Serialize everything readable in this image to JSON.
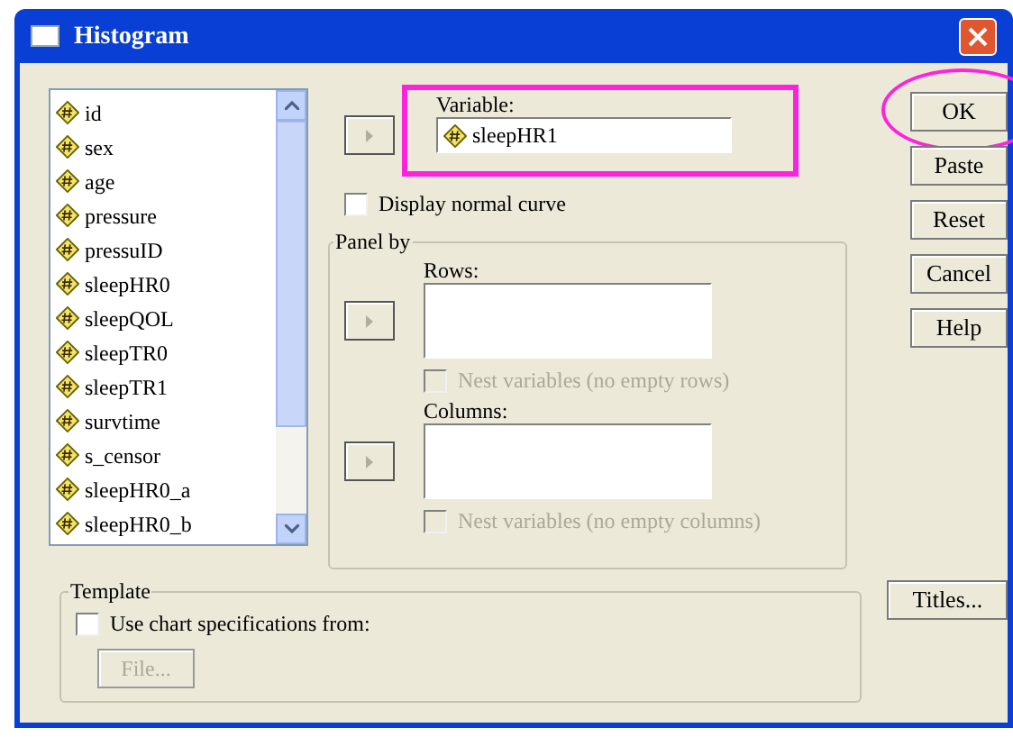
{
  "window": {
    "title": "Histogram"
  },
  "variables": [
    "id",
    "sex",
    "age",
    "pressure",
    "pressuID",
    "sleepHR0",
    "sleepQOL",
    "sleepTR0",
    "sleepTR1",
    "survtime",
    "s_censor",
    "sleepHR0_a",
    "sleepHR0_b"
  ],
  "variable": {
    "label": "Variable:",
    "value": "sleepHR1",
    "annotated": true
  },
  "normal_curve": {
    "label": "Display normal curve",
    "checked": false
  },
  "panel_by": {
    "title": "Panel by",
    "rows": {
      "label": "Rows:",
      "nest_label": "Nest variables (no empty rows)",
      "nest_checked": false,
      "nest_disabled": true
    },
    "columns": {
      "label": "Columns:",
      "nest_label": "Nest variables (no empty columns)",
      "nest_checked": false,
      "nest_disabled": true
    }
  },
  "template": {
    "title": "Template",
    "checkbox_label": "Use chart specifications from:",
    "checked": false,
    "file_button": {
      "label": "File...",
      "disabled": true
    }
  },
  "buttons": [
    {
      "label": "OK",
      "annotated": true
    },
    {
      "label": "Paste",
      "annotated": false
    },
    {
      "label": "Reset",
      "annotated": false
    },
    {
      "label": "Cancel",
      "annotated": false
    },
    {
      "label": "Help",
      "annotated": false
    }
  ],
  "titles_button": {
    "label": "Titles..."
  }
}
